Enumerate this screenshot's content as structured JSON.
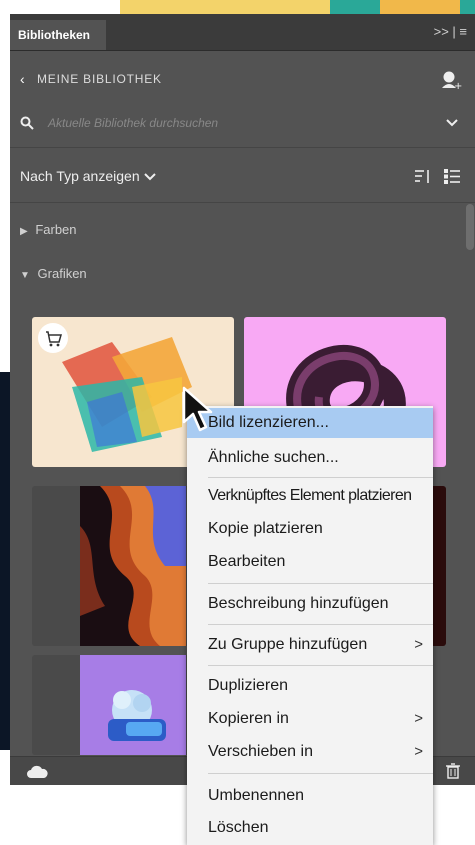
{
  "panel": {
    "tab_label": "Bibliotheken",
    "tab_controls": ">> | ≡",
    "breadcrumb": "MEINE BIBLIOTHEK",
    "search_placeholder": "Aktuelle Bibliothek durchsuchen",
    "filter_label": "Nach Typ anzeigen",
    "sections": [
      {
        "label": "Farben",
        "expanded": false
      },
      {
        "label": "Grafiken",
        "expanded": true
      }
    ]
  },
  "context_menu": {
    "items": [
      {
        "label": "Bild lizenzieren...",
        "highlighted": true
      },
      {
        "label": "Ähnliche suchen..."
      },
      {
        "label": "Verknüpftes Element platzieren"
      },
      {
        "label": "Kopie platzieren"
      },
      {
        "label": "Bearbeiten"
      },
      {
        "label": "Beschreibung hinzufügen"
      },
      {
        "label": "Zu Gruppe hinzufügen",
        "submenu": true
      },
      {
        "label": "Duplizieren"
      },
      {
        "label": "Kopieren in",
        "submenu": true
      },
      {
        "label": "Verschieben in",
        "submenu": true
      },
      {
        "label": "Umbenennen"
      },
      {
        "label": "Löschen"
      }
    ],
    "submenu_arrow": ">"
  },
  "colors": {
    "panel_bg": "#535353",
    "tabbar_bg": "#3b3b3b",
    "menu_bg": "#f3f3f3",
    "menu_highlight": "#a8cbf2"
  }
}
